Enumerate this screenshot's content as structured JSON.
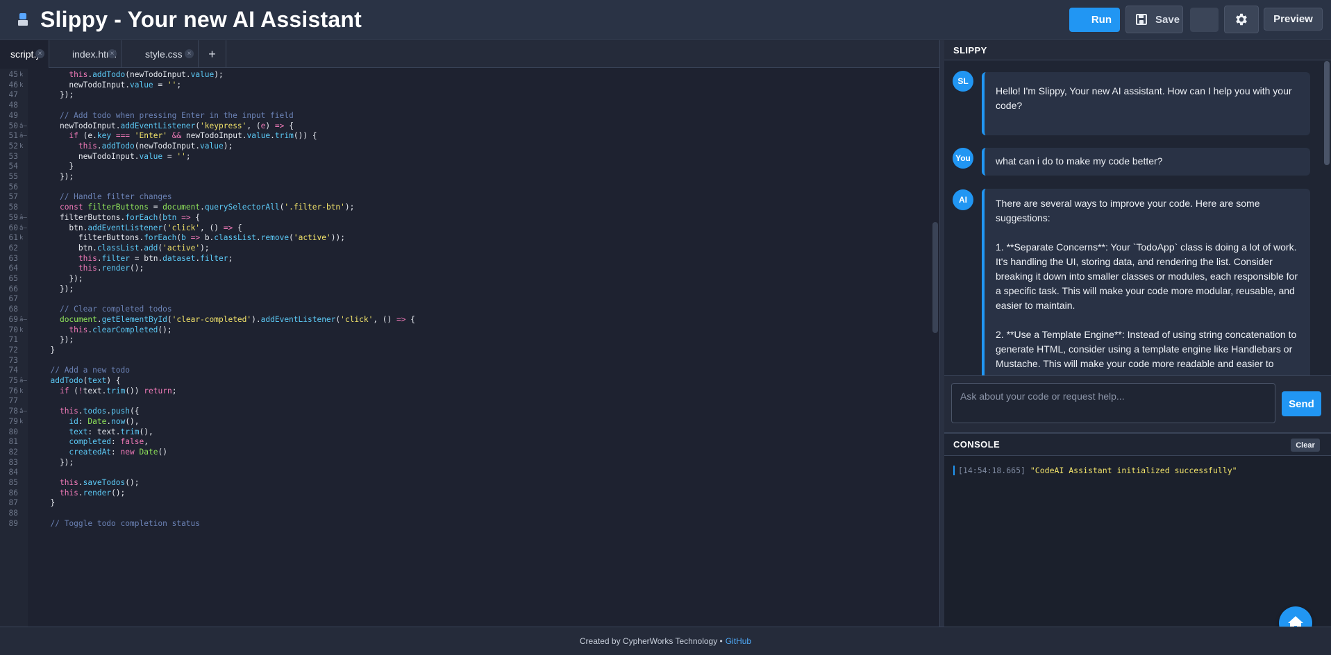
{
  "header": {
    "title": "Slippy - Your new AI Assistant",
    "run_label": "Run",
    "save_label": "Save",
    "preview_label": "Preview"
  },
  "tabs": [
    {
      "label": "script.js",
      "active": true
    },
    {
      "label": "index.html",
      "active": false
    },
    {
      "label": "style.css",
      "active": false
    }
  ],
  "tab_add_label": "+",
  "code_lines": [
    {
      "n": "45",
      "fold": "k",
      "html": "      <span class='kw'>this</span>.<span class='fn'>addTodo</span>(newTodoInput.<span class='prop'>value</span>);"
    },
    {
      "n": "46",
      "fold": "k",
      "html": "      newTodoInput.<span class='prop'>value</span> = <span class='str'>''</span>;"
    },
    {
      "n": "47",
      "fold": "",
      "html": "    });"
    },
    {
      "n": "48",
      "fold": "",
      "html": ""
    },
    {
      "n": "49",
      "fold": "",
      "html": "    <span class='cm'>// Add todo when pressing Enter in the input field</span>"
    },
    {
      "n": "50",
      "fold": "â–",
      "html": "    newTodoInput.<span class='fn'>addEventListener</span>(<span class='str'>'keypress'</span>, (<span class='kw'>e</span>) <span class='kw'>=&gt;</span> {"
    },
    {
      "n": "51",
      "fold": "â–",
      "html": "      <span class='kw'>if</span> (e.<span class='prop'>key</span> <span class='kw'>===</span> <span class='str'>'Enter'</span> <span class='kw'>&amp;&amp;</span> newTodoInput.<span class='prop'>value</span>.<span class='fn'>trim</span>()) {"
    },
    {
      "n": "52",
      "fold": "k",
      "html": "        <span class='kw'>this</span>.<span class='fn'>addTodo</span>(newTodoInput.<span class='prop'>value</span>);"
    },
    {
      "n": "53",
      "fold": "",
      "html": "        newTodoInput.<span class='prop'>value</span> = <span class='str'>''</span>;"
    },
    {
      "n": "54",
      "fold": "",
      "html": "      }"
    },
    {
      "n": "55",
      "fold": "",
      "html": "    });"
    },
    {
      "n": "56",
      "fold": "",
      "html": ""
    },
    {
      "n": "57",
      "fold": "",
      "html": "    <span class='cm'>// Handle filter changes</span>"
    },
    {
      "n": "58",
      "fold": "",
      "html": "    <span class='kw'>const</span> <span class='cls'>filterButtons</span> = <span class='obj'>document</span>.<span class='fn'>querySelectorAll</span>(<span class='str'>'.filter-btn'</span>);"
    },
    {
      "n": "59",
      "fold": "â–",
      "html": "    filterButtons.<span class='fn'>forEach</span>(<span class='fn'>btn</span> <span class='kw'>=&gt;</span> {"
    },
    {
      "n": "60",
      "fold": "â–",
      "html": "      btn.<span class='fn'>addEventListener</span>(<span class='str'>'click'</span>, () <span class='kw'>=&gt;</span> {"
    },
    {
      "n": "61",
      "fold": "k",
      "html": "        filterButtons.<span class='fn'>forEach</span>(<span class='fn'>b</span> <span class='kw'>=&gt;</span> b.<span class='prop'>classList</span>.<span class='fn'>remove</span>(<span class='str'>'active'</span>));"
    },
    {
      "n": "62",
      "fold": "",
      "html": "        btn.<span class='prop'>classList</span>.<span class='fn'>add</span>(<span class='str'>'active'</span>);"
    },
    {
      "n": "63",
      "fold": "",
      "html": "        <span class='kw'>this</span>.<span class='prop'>filter</span> = btn.<span class='prop'>dataset</span>.<span class='prop'>filter</span>;"
    },
    {
      "n": "64",
      "fold": "",
      "html": "        <span class='kw'>this</span>.<span class='fn'>render</span>();"
    },
    {
      "n": "65",
      "fold": "",
      "html": "      });"
    },
    {
      "n": "66",
      "fold": "",
      "html": "    });"
    },
    {
      "n": "67",
      "fold": "",
      "html": ""
    },
    {
      "n": "68",
      "fold": "",
      "html": "    <span class='cm'>// Clear completed todos</span>"
    },
    {
      "n": "69",
      "fold": "â–",
      "html": "    <span class='obj'>document</span>.<span class='fn'>getElementById</span>(<span class='str'>'clear-completed'</span>).<span class='fn'>addEventListener</span>(<span class='str'>'click'</span>, () <span class='kw'>=&gt;</span> {"
    },
    {
      "n": "70",
      "fold": "k",
      "html": "      <span class='kw'>this</span>.<span class='fn'>clearCompleted</span>();"
    },
    {
      "n": "71",
      "fold": "",
      "html": "    });"
    },
    {
      "n": "72",
      "fold": "",
      "html": "  }"
    },
    {
      "n": "73",
      "fold": "",
      "html": ""
    },
    {
      "n": "74",
      "fold": "",
      "html": "  <span class='cm'>// Add a new todo</span>"
    },
    {
      "n": "75",
      "fold": "â–",
      "html": "  <span class='fn'>addTodo</span>(<span class='prop'>text</span>) {"
    },
    {
      "n": "76",
      "fold": "k",
      "html": "    <span class='kw'>if</span> (<span class='kw'>!</span>text.<span class='fn'>trim</span>()) <span class='kw'>return</span>;"
    },
    {
      "n": "77",
      "fold": "",
      "html": ""
    },
    {
      "n": "78",
      "fold": "â–",
      "html": "    <span class='kw'>this</span>.<span class='prop'>todos</span>.<span class='fn'>push</span>({"
    },
    {
      "n": "79",
      "fold": "k",
      "html": "      <span class='prop'>id</span>: <span class='cls'>Date</span>.<span class='fn'>now</span>(),"
    },
    {
      "n": "80",
      "fold": "",
      "html": "      <span class='prop'>text</span>: text.<span class='fn'>trim</span>(),"
    },
    {
      "n": "81",
      "fold": "",
      "html": "      <span class='prop'>completed</span>: <span class='kw'>false</span>,"
    },
    {
      "n": "82",
      "fold": "",
      "html": "      <span class='prop'>createdAt</span>: <span class='kw'>new</span> <span class='cls'>Date</span>()"
    },
    {
      "n": "83",
      "fold": "",
      "html": "    });"
    },
    {
      "n": "84",
      "fold": "",
      "html": ""
    },
    {
      "n": "85",
      "fold": "",
      "html": "    <span class='kw'>this</span>.<span class='fn'>saveTodos</span>();"
    },
    {
      "n": "86",
      "fold": "",
      "html": "    <span class='kw'>this</span>.<span class='fn'>render</span>();"
    },
    {
      "n": "87",
      "fold": "",
      "html": "  }"
    },
    {
      "n": "88",
      "fold": "",
      "html": ""
    },
    {
      "n": "89",
      "fold": "",
      "html": "  <span class='cm'>// Toggle todo completion status</span>"
    }
  ],
  "chat": {
    "title": "SLIPPY",
    "messages": [
      {
        "avatar": "SL",
        "paragraphs": [
          "Hello! I'm Slippy, Your new AI assistant. How can I help you with your code?"
        ]
      },
      {
        "avatar": "You",
        "paragraphs": [
          "what can i do to make my code better?"
        ]
      },
      {
        "avatar": "AI",
        "paragraphs": [
          "There are several ways to improve your code. Here are some suggestions:",
          "1. **Separate Concerns**: Your `TodoApp` class is doing a lot of work. It's handling the UI, storing data, and rendering the list. Consider breaking it down into smaller classes or modules, each responsible for a specific task. This will make your code more modular, reusable, and easier to maintain.",
          "2. **Use a Template Engine**: Instead of using string concatenation to generate HTML, consider using a template engine like Handlebars or Mustache. This will make your code more readable and easier to"
        ]
      }
    ],
    "input_placeholder": "Ask about your code or request help...",
    "send_label": "Send"
  },
  "console": {
    "title": "CONSOLE",
    "clear_label": "Clear",
    "logs": [
      {
        "time": "[14:54:18.665]",
        "message": "\"CodeAI Assistant initialized successfully\""
      }
    ]
  },
  "footer": {
    "text": "Created by CypherWorks Technology •",
    "link": "GitHub"
  },
  "colors": {
    "accent": "#2196f3",
    "background": "#1e2433",
    "panel": "#252b3a"
  }
}
